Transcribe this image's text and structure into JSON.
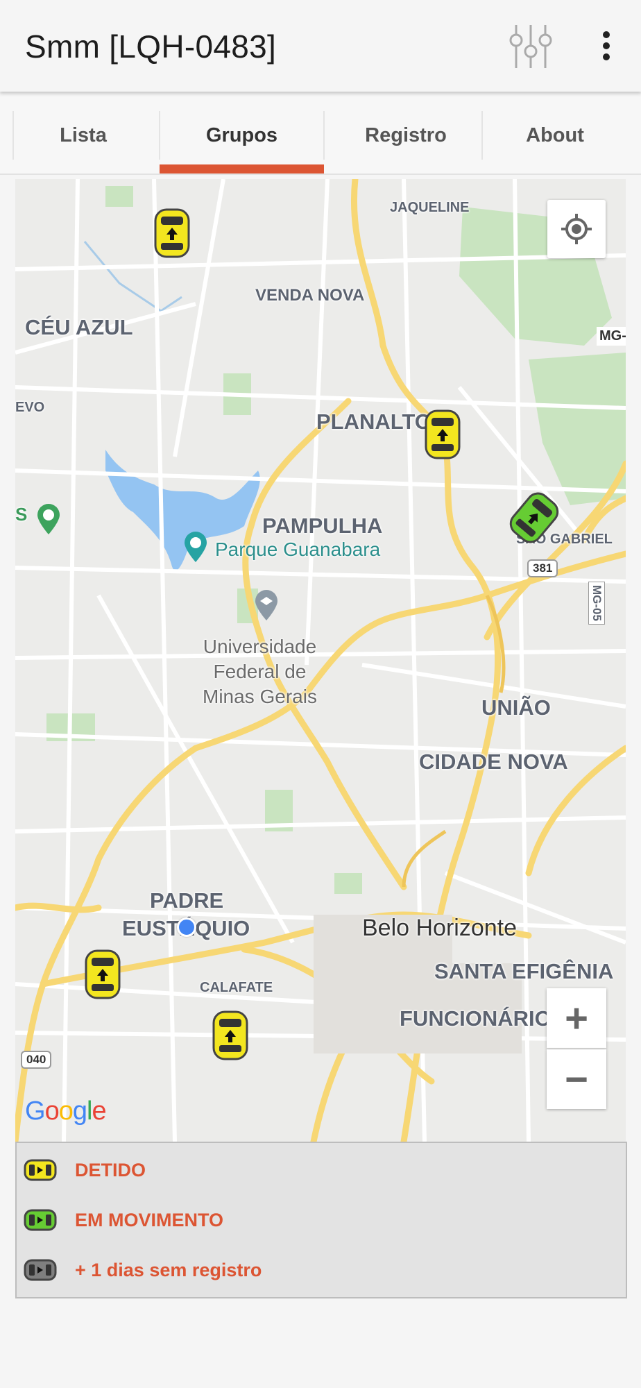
{
  "app_bar": {
    "title": "Smm [LQH-0483]",
    "filter_icon": "tune-sliders-icon",
    "more_icon": "more-vert-icon"
  },
  "tabs": [
    {
      "label": "Lista",
      "selected": false
    },
    {
      "label": "Grupos",
      "selected": true
    },
    {
      "label": "Registro",
      "selected": false
    },
    {
      "label": "About",
      "selected": false
    }
  ],
  "accent_color": "#dc5533",
  "map": {
    "labels": {
      "jaqueline": "JAQUELINE",
      "venda_nova": "VENDA NOVA",
      "ceu_azul": "CÉU AZUL",
      "evo": "EVO",
      "planalto": "PLANALTO",
      "mg_road": "MG-",
      "pampulha": "PAMPULHA",
      "parque": "Parque Guanabara",
      "sao_gabriel": "SÃO GABRIEL",
      "s_left": "S",
      "univ_1": "Universidade",
      "univ_2": "Federal de",
      "univ_3": "Minas Gerais",
      "uniao": "UNIÃO",
      "cidade_nova": "CIDADE NOVA",
      "padre": "PADRE",
      "eustaquio": "EUSTÁQUIO",
      "belo_horizonte": "Belo Horizonte",
      "santa_efigenia": "SANTA EFIGÊNIA",
      "calafate": "CALAFATE",
      "funcionarios": "FUNCIONÁRIOS",
      "route_381": "381",
      "route_040": "040",
      "route_mg05": "MG-05",
      "google": "Google"
    },
    "controls": {
      "locate_icon": "my-location-icon",
      "zoom_in": "+",
      "zoom_out": "−"
    }
  },
  "legend": [
    {
      "label": "DETIDO",
      "color": "#f3e61f"
    },
    {
      "label": "EM MOVIMENTO",
      "color": "#66cc33"
    },
    {
      "label": "+ 1 dias sem registro",
      "color": "#7f7f7f"
    }
  ]
}
